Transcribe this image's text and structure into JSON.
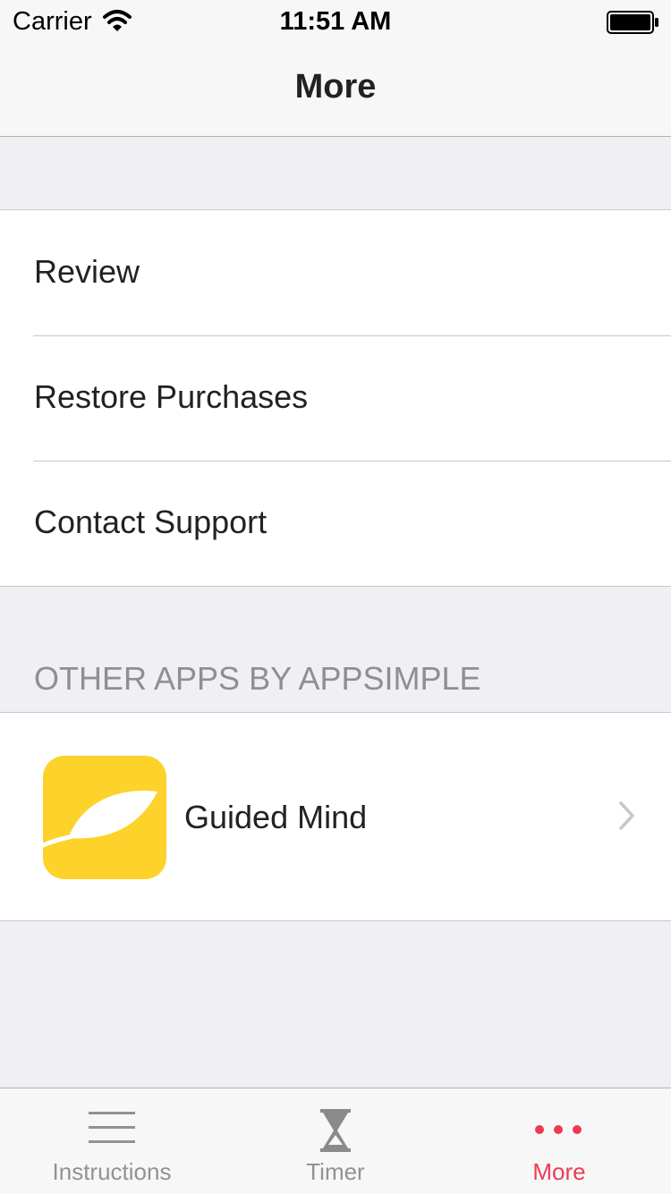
{
  "status_bar": {
    "carrier": "Carrier",
    "time": "11:51 AM",
    "wifi_icon": "wifi-icon",
    "battery_icon": "battery-icon"
  },
  "nav": {
    "title": "More"
  },
  "settings": {
    "items": [
      {
        "label": "Review"
      },
      {
        "label": "Restore Purchases"
      },
      {
        "label": "Contact Support"
      }
    ]
  },
  "other_apps": {
    "header": "OTHER APPS BY APPSIMPLE",
    "items": [
      {
        "name": "Guided Mind",
        "icon": "leaf-icon",
        "accessory": "chevron-right-icon"
      }
    ]
  },
  "tab_bar": {
    "tabs": [
      {
        "label": "Instructions",
        "icon": "list-icon",
        "selected": false
      },
      {
        "label": "Timer",
        "icon": "hourglass-icon",
        "selected": false
      },
      {
        "label": "More",
        "icon": "more-dots-icon",
        "selected": true
      }
    ]
  },
  "colors": {
    "accent": "#ee3a55",
    "app_icon_bg": "#fdd22a",
    "background": "#efeff4",
    "inactive_tab": "#929292",
    "section_header": "#8e8e93"
  }
}
